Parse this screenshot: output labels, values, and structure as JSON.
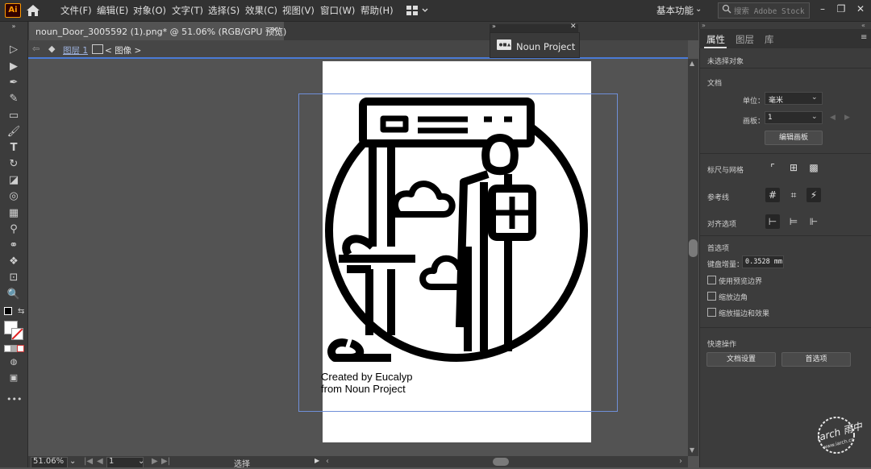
{
  "app": {
    "logo": "Ai"
  },
  "menu": [
    "文件(F)",
    "编辑(E)",
    "对象(O)",
    "文字(T)",
    "选择(S)",
    "效果(C)",
    "视图(V)",
    "窗口(W)",
    "帮助(H)"
  ],
  "workspace": {
    "label": "基本功能"
  },
  "search": {
    "placeholder": "搜索 Adobe Stock"
  },
  "document": {
    "tab_label": "noun_Door_3005592 (1).png* @ 51.06% (RGB/GPU 预览)",
    "close": "×",
    "breadcrumb_layer": "图层 1",
    "breadcrumb_item": "< 图像 >"
  },
  "noun_panel": {
    "label": "Noun Project"
  },
  "artwork": {
    "credit_line1": "Created by Eucalyp",
    "credit_line2": "from Noun Project"
  },
  "status": {
    "zoom": "51.06%",
    "page": "1",
    "tool": "选择"
  },
  "panel": {
    "tabs": [
      "属性",
      "图层",
      "库"
    ],
    "no_selection": "未选择对象",
    "document_section": "文档",
    "units_label": "单位：",
    "units_value": "毫米",
    "artboard_label": "画板：",
    "artboard_value": "1",
    "edit_artboards": "编辑画板",
    "rulers_grids": "标尺与网格",
    "guides": "参考线",
    "snap_options": "对齐选项",
    "preferences": "首选项",
    "keyboard_increment_label": "键盘增量：",
    "keyboard_increment_value": "0.3528 mm",
    "use_preview_bounds": "使用预览边界",
    "scale_corners": "缩放边角",
    "scale_strokes": "缩放描边和效果",
    "quick_actions": "快速操作",
    "document_setup": "文档设置",
    "preferences_btn": "首选项"
  },
  "watermark": {
    "text": "iarch 雨中",
    "sub": "www.iarch.cn"
  },
  "colors": {
    "accent_blue": "#4a7bd6",
    "bbox": "#6f8fd8",
    "ai_orange": "#ff9a00"
  }
}
